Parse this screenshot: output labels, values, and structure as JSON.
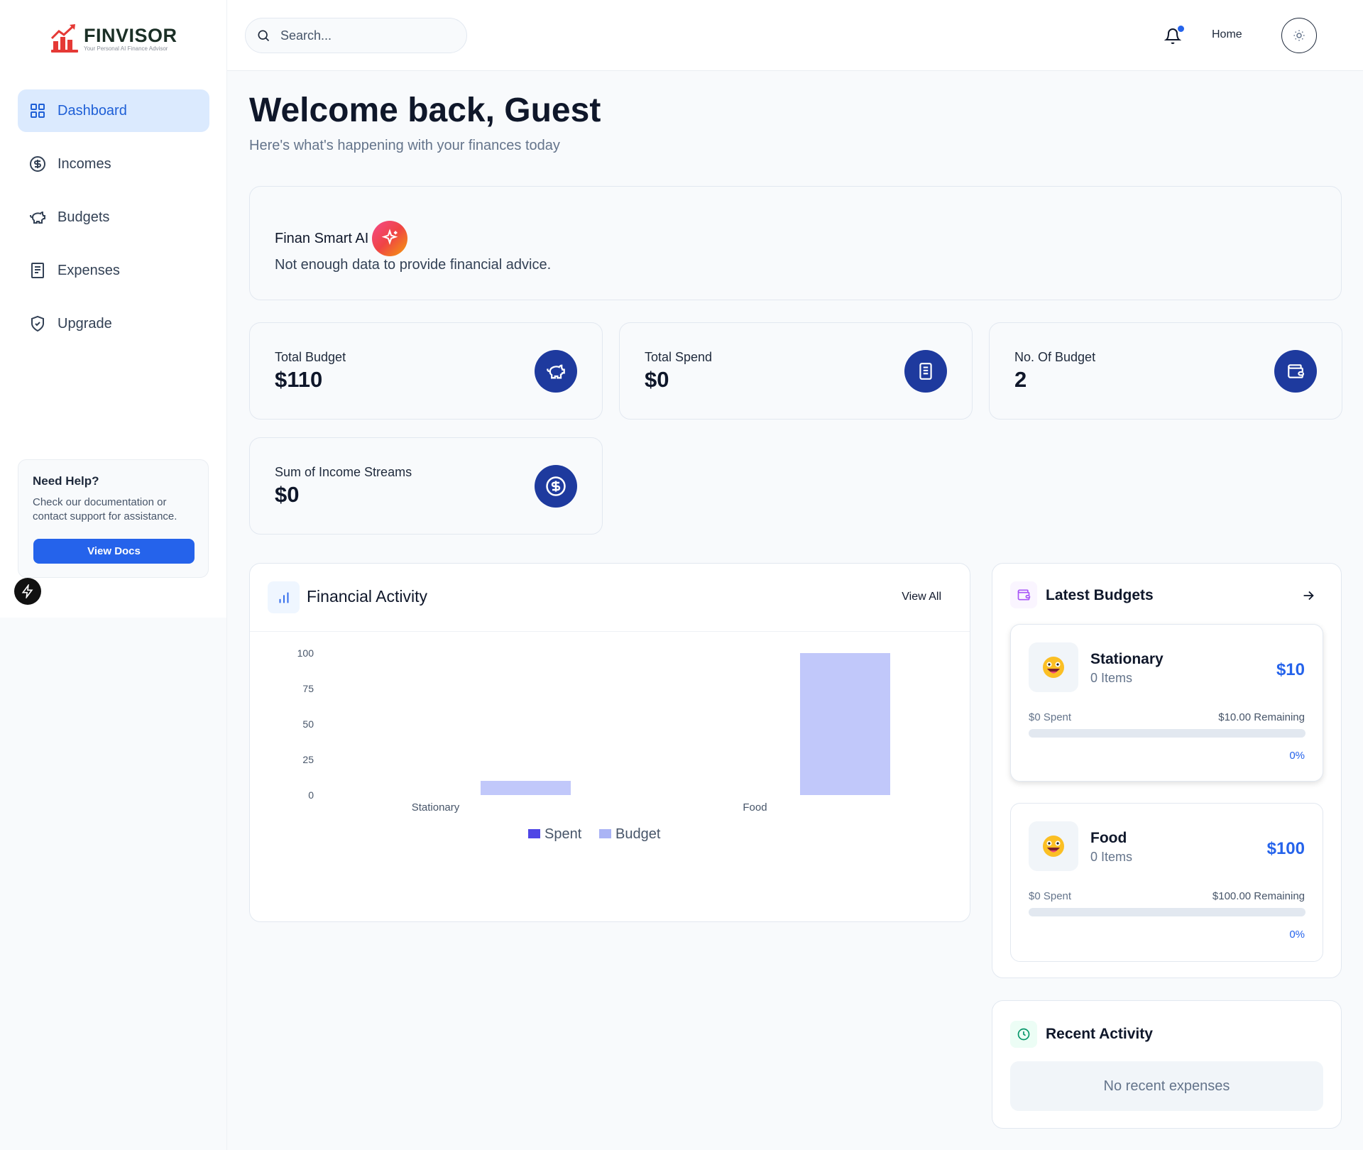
{
  "brand": {
    "name": "FINVISOR",
    "tagline": "Your Personal AI Finance Advisor"
  },
  "sidebar": {
    "items": [
      {
        "label": "Dashboard",
        "icon": "grid-icon",
        "active": true
      },
      {
        "label": "Incomes",
        "icon": "dollar-circle-icon"
      },
      {
        "label": "Budgets",
        "icon": "piggy-bank-icon"
      },
      {
        "label": "Expenses",
        "icon": "receipt-icon"
      },
      {
        "label": "Upgrade",
        "icon": "shield-check-icon"
      }
    ],
    "help": {
      "title": "Need Help?",
      "text": "Check our documentation or contact support for assistance.",
      "button": "View Docs"
    }
  },
  "header": {
    "search_placeholder": "Search...",
    "home_label": "Home"
  },
  "welcome": {
    "title": "Welcome back, Guest",
    "subtitle": "Here's what's happening with your finances today"
  },
  "ai": {
    "title": "Finan Smart AI",
    "message": "Not enough data to provide financial advice."
  },
  "stats": [
    {
      "label": "Total Budget",
      "value": "$110",
      "icon": "piggy-bank-icon"
    },
    {
      "label": "Total Spend",
      "value": "$0",
      "icon": "receipt-icon"
    },
    {
      "label": "No. Of Budget",
      "value": "2",
      "icon": "wallet-icon"
    },
    {
      "label": "Sum of Income Streams",
      "value": "$0",
      "icon": "dollar-circle-icon"
    }
  ],
  "financial_activity": {
    "title": "Financial Activity",
    "view_all": "View All"
  },
  "chart_data": {
    "type": "bar",
    "categories": [
      "Stationary",
      "Food"
    ],
    "series": [
      {
        "name": "Spent",
        "values": [
          0,
          0
        ],
        "color": "#4f46e5"
      },
      {
        "name": "Budget",
        "values": [
          10,
          100
        ],
        "color": "#c1c8fa"
      }
    ],
    "yticks": [
      0,
      25,
      50,
      75,
      100
    ],
    "ylim": [
      0,
      100
    ],
    "legend": "bottom",
    "legend_colors": {
      "Spent": "#4f46e5",
      "Budget": "#aab4f5"
    }
  },
  "latest_budgets": {
    "title": "Latest Budgets",
    "items": [
      {
        "name": "Stationary",
        "items": "0 Items",
        "amount": "$10",
        "spent": "$0 Spent",
        "remaining": "$10.00 Remaining",
        "percent": "0%",
        "progress": 0
      },
      {
        "name": "Food",
        "items": "0 Items",
        "amount": "$100",
        "spent": "$0 Spent",
        "remaining": "$100.00 Remaining",
        "percent": "0%",
        "progress": 0
      }
    ]
  },
  "recent_activity": {
    "title": "Recent Activity",
    "empty": "No recent expenses"
  },
  "colors": {
    "primary": "#2563eb",
    "stat_icon_bg": "#1e3a9e",
    "active_nav_bg": "#dbeafe"
  }
}
